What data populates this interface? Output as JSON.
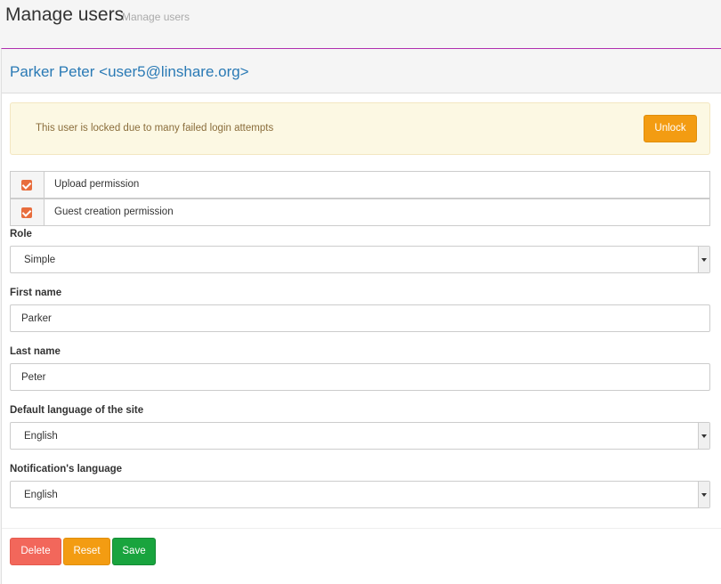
{
  "header": {
    "title": "Manage users",
    "breadcrumb": "Manage users"
  },
  "panel": {
    "title": "Parker Peter <user5@linshare.org>"
  },
  "alert": {
    "message": "This user is locked due to many failed login attempts",
    "unlock_label": "Unlock"
  },
  "permissions": [
    {
      "label": "Upload permission",
      "checked": true
    },
    {
      "label": "Guest creation permission",
      "checked": true
    }
  ],
  "form": {
    "role": {
      "label": "Role",
      "value": "Simple"
    },
    "first_name": {
      "label": "First name",
      "value": "Parker"
    },
    "last_name": {
      "label": "Last name",
      "value": "Peter"
    },
    "site_language": {
      "label": "Default language of the site",
      "value": "English"
    },
    "notification_language": {
      "label": "Notification's language",
      "value": "English"
    }
  },
  "actions": {
    "delete_label": "Delete",
    "reset_label": "Reset",
    "save_label": "Save"
  },
  "colors": {
    "accent_border": "#b02fb0",
    "title_blue": "#2a7ab5",
    "delete": "#f2675b",
    "reset": "#f39c12",
    "save": "#19a43e",
    "checkbox": "#e86d3d"
  }
}
